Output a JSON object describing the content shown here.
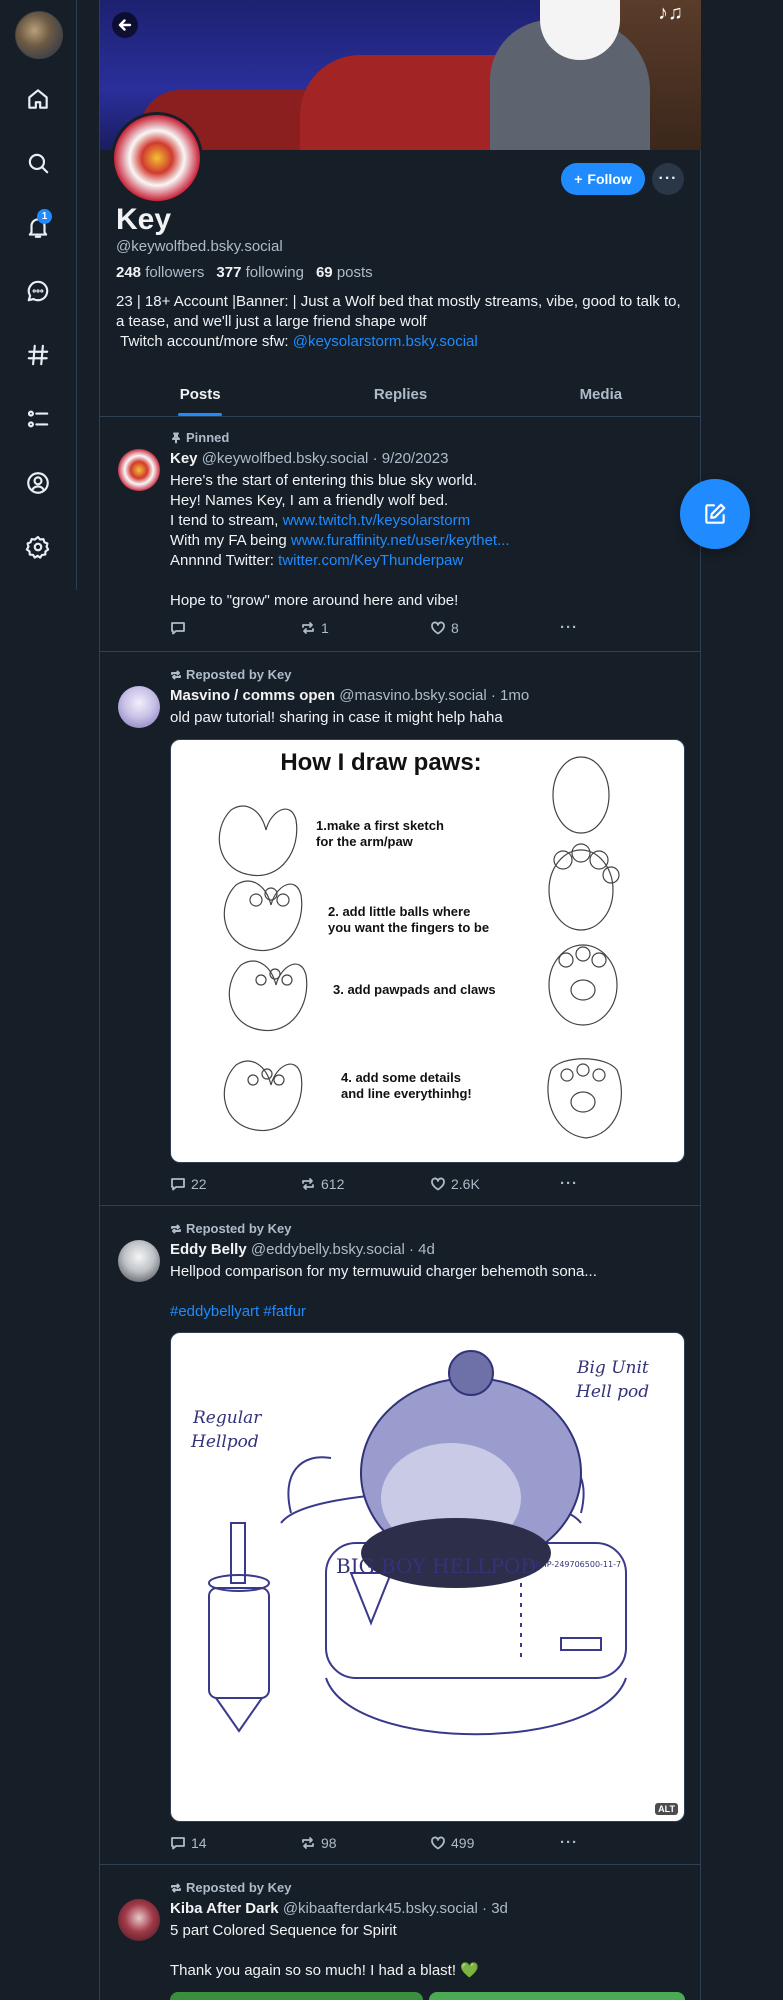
{
  "nav": {
    "notification_count": "1"
  },
  "profile": {
    "display_name": "Key",
    "handle": "@keywolfbed.bsky.social",
    "followers_count": "248",
    "followers_label": "followers",
    "following_count": "377",
    "following_label": "following",
    "posts_count": "69",
    "posts_label": "posts",
    "bio_line1": "23 | 18+ Account |Banner: | Just a Wolf bed that mostly streams, vibe, good to talk to, a tease, and we'll just a large friend shape wolf",
    "bio_line2": " Twitch account/more sfw: ",
    "bio_link": "@keysolarstorm.bsky.social",
    "follow_label": "Follow",
    "more_label": "···"
  },
  "tabs": [
    {
      "label": "Posts"
    },
    {
      "label": "Replies"
    },
    {
      "label": "Media"
    }
  ],
  "posts": [
    {
      "label": "Pinned",
      "author": "Key",
      "handle": "@keywolfbed.bsky.social",
      "time": "· 9/20/2023",
      "lines": [
        {
          "text": "Here's the start of entering this blue sky world."
        },
        {
          "text": "Hey! Names Key, I am a friendly wolf bed."
        },
        {
          "text": "I tend to stream, ",
          "link": "www.twitch.tv/keysolarstorm"
        },
        {
          "text": "With my FA being ",
          "link": "www.furaffinity.net/user/keythet..."
        },
        {
          "text": "Annnnd Twitter: ",
          "link": "twitter.com/KeyThunderpaw"
        },
        {
          "text": " "
        },
        {
          "text": "Hope to \"grow\" more around here and vibe!"
        }
      ],
      "replies": "",
      "reposts": "1",
      "likes": "8"
    },
    {
      "label": "Reposted by Key",
      "author": "Masvino / comms open",
      "handle": "@masvino.bsky.social",
      "time": "· 1mo",
      "text": "old paw tutorial! sharing in case it might help haha",
      "image": {
        "title": "How I draw paws:",
        "steps": [
          "1.make a first sketch\nfor the arm/paw",
          "2. add little balls where\nyou want the fingers to be",
          "3. add pawpads and claws",
          "4. add some details\nand line everythinhg!"
        ]
      },
      "replies": "22",
      "reposts": "612",
      "likes": "2.6K"
    },
    {
      "label": "Reposted by Key",
      "author": "Eddy Belly",
      "handle": "@eddybelly.bsky.social",
      "time": "· 4d",
      "text": "Hellpod comparison for my termuwuid charger behemoth sona...",
      "tags": "#eddybellyart #fatfur",
      "image": {
        "left_label": "Regular\nHellpod",
        "right_label": "Big Unit\nHell pod",
        "pod_label": "BIG BOY HELLPOD",
        "serial": "#BBHP-249706500-11-7",
        "alt": "ALT"
      },
      "replies": "14",
      "reposts": "98",
      "likes": "499"
    },
    {
      "label": "Reposted by Key",
      "author": "Kiba After Dark",
      "handle": "@kibaafterdark45.bsky.social",
      "time": "· 3d",
      "text": "5 part Colored Sequence for Spirit",
      "text2": "Thank you again so so much! I had a blast! 💚"
    }
  ],
  "colors": {
    "background": "#161e27",
    "accent": "#208bfe",
    "border": "#2e4052",
    "muted_text": "#aebbc9"
  },
  "icons": [
    "home-icon",
    "search-icon",
    "bell-icon",
    "chat-icon",
    "hashtag-icon",
    "list-icon",
    "profile-icon",
    "settings-icon",
    "back-arrow-icon",
    "compose-icon",
    "pin-icon",
    "repost-icon",
    "reply-icon",
    "like-icon",
    "plus-icon"
  ]
}
